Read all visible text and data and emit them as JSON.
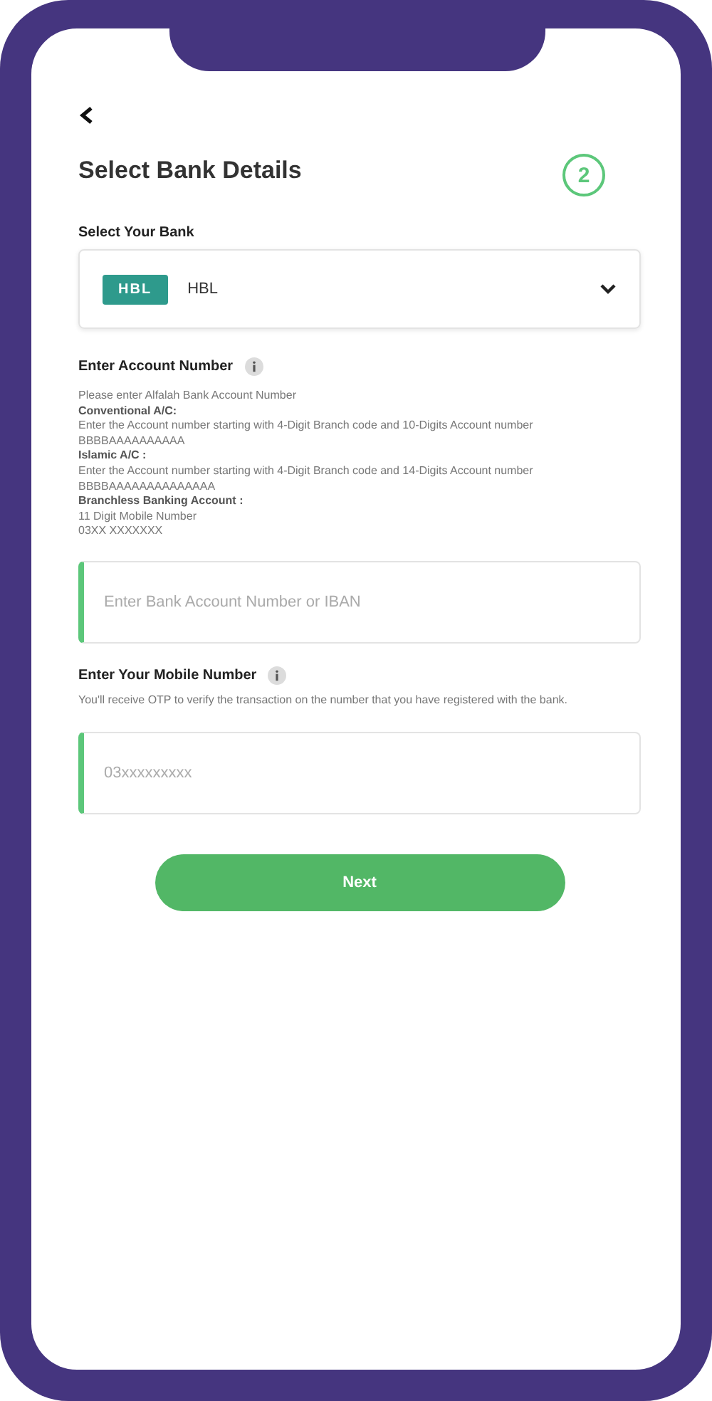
{
  "header": {
    "title": "Select Bank Details",
    "step": "2"
  },
  "bank": {
    "label": "Select Your Bank",
    "logo": "HBL",
    "value": "HBL"
  },
  "account": {
    "label": "Enter Account Number",
    "help": [
      {
        "kind": "text",
        "text": "Please enter Alfalah Bank Account Number"
      },
      {
        "kind": "heading",
        "text": "Conventional A/C:"
      },
      {
        "kind": "text",
        "text": "Enter the Account number starting with 4-Digit Branch code and 10-Digits Account number"
      },
      {
        "kind": "text",
        "text": "BBBBAAAAAAAAAA"
      },
      {
        "kind": "heading",
        "text": "Islamic A/C :"
      },
      {
        "kind": "text",
        "text": "Enter the Account number starting with 4-Digit Branch code and 14-Digits Account number"
      },
      {
        "kind": "text",
        "text": "BBBBAAAAAAAAAAAAAA"
      },
      {
        "kind": "heading",
        "text": "Branchless Banking Account :"
      },
      {
        "kind": "text",
        "text": "11 Digit Mobile Number"
      },
      {
        "kind": "text",
        "text": "03XX XXXXXXX"
      }
    ],
    "placeholder": "Enter Bank Account Number or IBAN"
  },
  "mobile": {
    "label": "Enter Your Mobile Number",
    "help": "You'll receive OTP to verify the transaction on the number that you have registered with the bank.",
    "placeholder": "03xxxxxxxxx"
  },
  "button": "Next"
}
